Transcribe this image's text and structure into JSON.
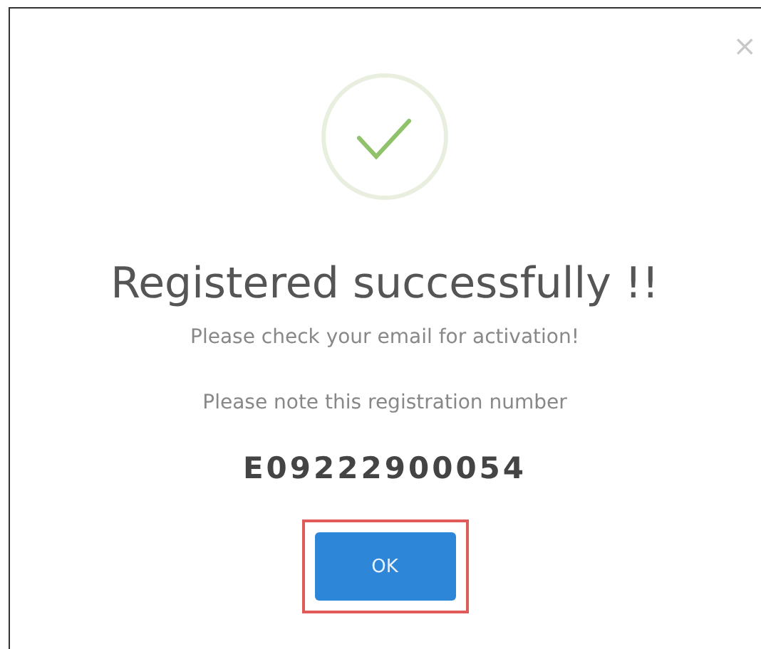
{
  "dialog": {
    "close": "×",
    "title": "Registered successfully !!",
    "messages": [
      "Please check your email for activation!",
      "Please note this registration number"
    ],
    "registration_number": "E09222900054",
    "button": {
      "label": "OK",
      "highlighted": true
    }
  }
}
